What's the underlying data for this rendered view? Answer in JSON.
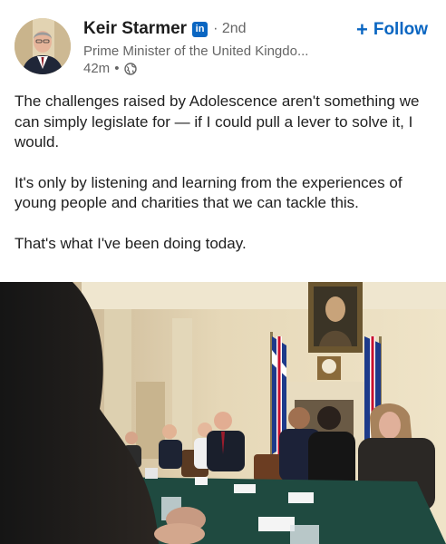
{
  "author": {
    "name": "Keir Starmer",
    "badge": "in",
    "degree": "2nd",
    "headline": "Prime Minister of the United Kingdo...",
    "timestamp": "42m",
    "dot": "•",
    "separator": "·"
  },
  "follow": {
    "label": "Follow",
    "plus": "+"
  },
  "post": {
    "paragraphs": [
      "The challenges raised by Adolescence aren't something we can simply legislate for — if I could pull a lever to solve it, I would.",
      "It's only by listening and learning from the experiences of young people and charities that we can tackle this.",
      "That's what I've been doing today."
    ]
  },
  "colors": {
    "brand": "#0a66c2",
    "meta_text": "#666666"
  },
  "icons": {
    "linkedin": "linkedin-badge-icon",
    "visibility": "globe-icon",
    "follow": "plus-icon"
  }
}
